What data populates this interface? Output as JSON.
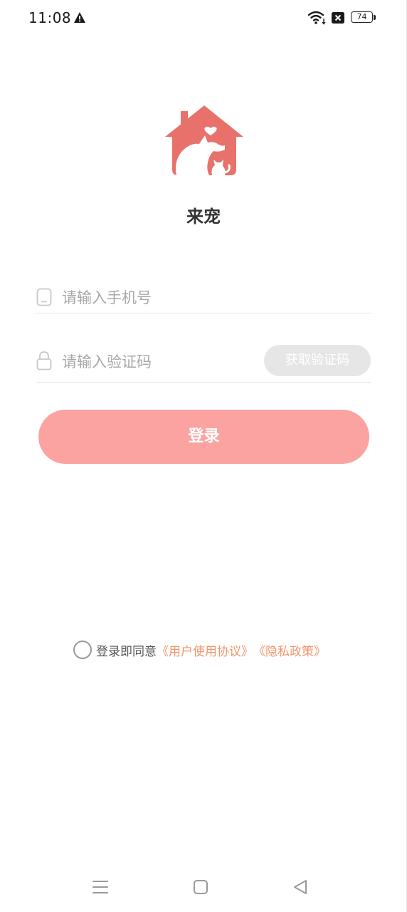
{
  "status_bar": {
    "time": "11:08",
    "battery": "74",
    "icons": [
      "alert-icon",
      "wifi-icon",
      "sim-icon",
      "battery-icon"
    ]
  },
  "app": {
    "name": "来宠",
    "logo_icon": "house-dog-cat-logo",
    "brand_color": "#e8726b"
  },
  "form": {
    "phone_placeholder": "请输入手机号",
    "phone_value": "",
    "code_placeholder": "请输入验证码",
    "code_value": "",
    "get_code_label": "获取验证码",
    "login_label": "登录",
    "login_color": "#fba3a1"
  },
  "agreement": {
    "prefix": "登录即同意",
    "user_agreement": "《用户使用协议》",
    "privacy_policy": "《隐私政策》",
    "link_color": "#f0956c"
  },
  "nav_bar": {
    "icons": [
      "menu-icon",
      "home-icon",
      "back-icon"
    ]
  }
}
